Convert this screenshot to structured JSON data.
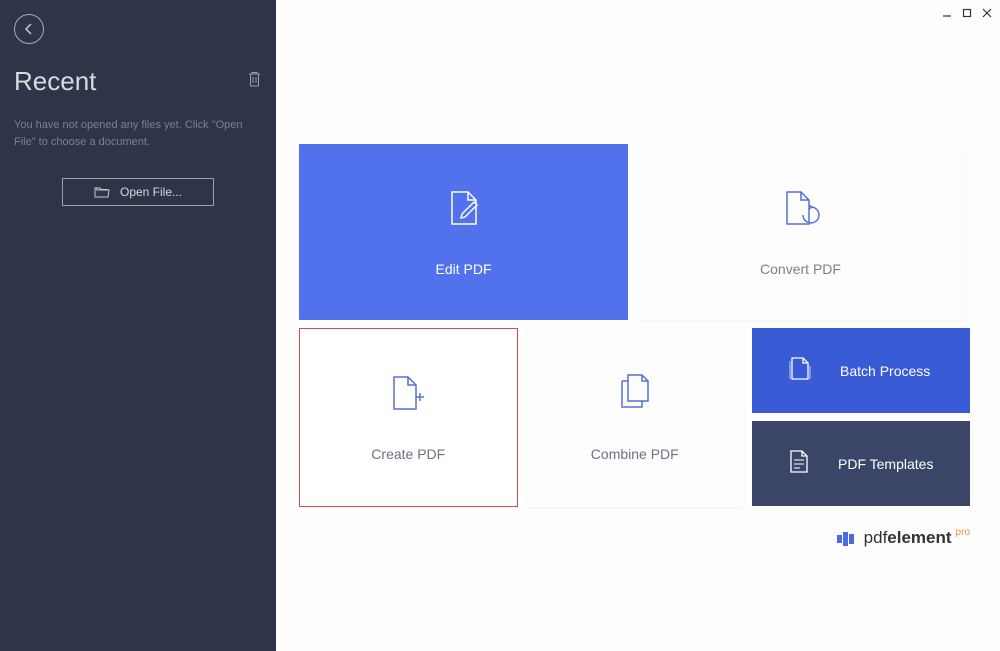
{
  "sidebar": {
    "title": "Recent",
    "message": "You have not opened any files yet. Click \"Open File\" to choose a document.",
    "open_file_label": "Open File..."
  },
  "cards": {
    "edit": "Edit PDF",
    "convert": "Convert PDF",
    "create": "Create PDF",
    "combine": "Combine PDF",
    "batch": "Batch Process",
    "templates": "PDF Templates"
  },
  "branding": {
    "name_light": "pdf",
    "name_bold": "element",
    "suffix": "pro"
  }
}
